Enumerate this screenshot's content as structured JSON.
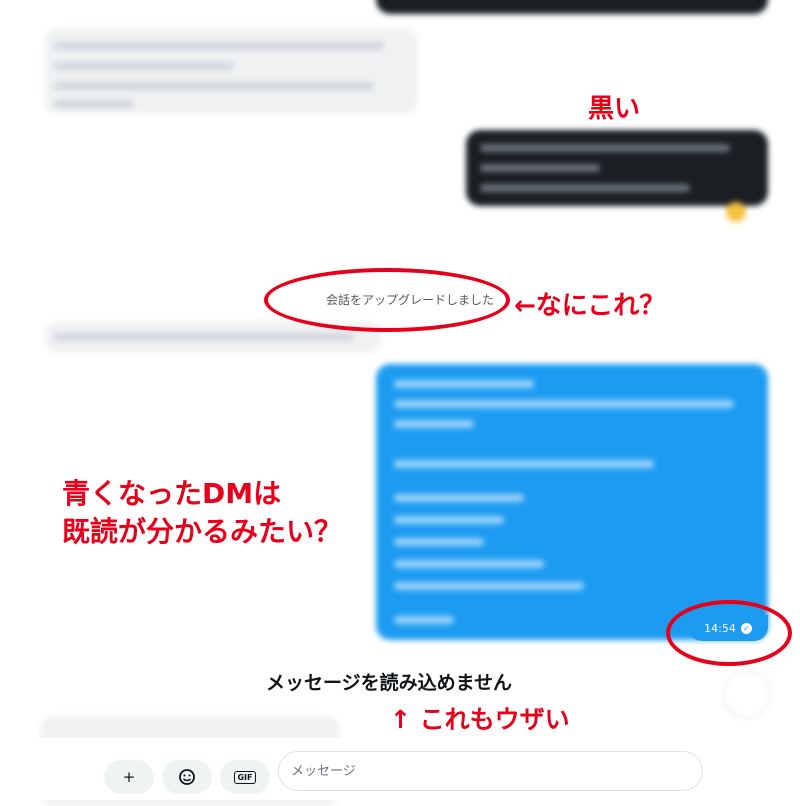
{
  "conversation": {
    "system_note": "会話をアップグレードしました",
    "last_message_time": "14:54",
    "load_error": "メッセージを読み込めません"
  },
  "annotations": {
    "black": "黒い",
    "what_is_this": "←なにこれ？",
    "blue_read": "青くなったDMは",
    "blue_read_2": "既読が分かるみたい？",
    "annoying": "↑ これもウザい"
  },
  "composer": {
    "placeholder": "メッセージ",
    "add_icon": "+",
    "sticker_icon": "smile-sticker-icon",
    "gif_label": "GIF"
  },
  "colors": {
    "accent_blue": "#1d9bf0",
    "annotation_red": "#e8001a",
    "black_bubble": "#1b1f23"
  }
}
